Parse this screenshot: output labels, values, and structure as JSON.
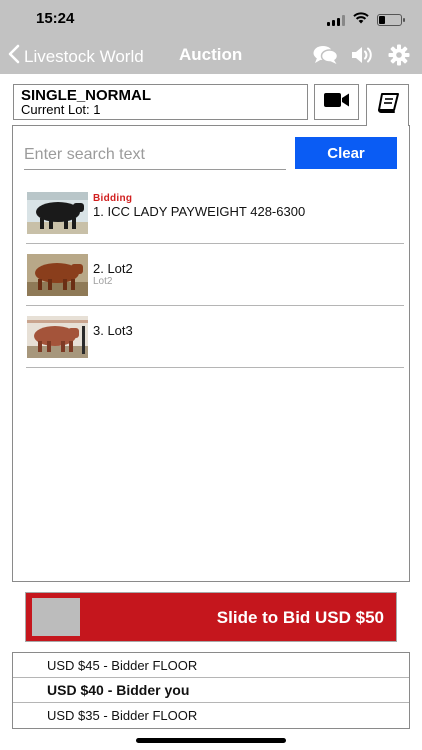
{
  "status_bar": {
    "time": "15:24"
  },
  "nav": {
    "back_label": "Livestock World",
    "title": "Auction",
    "icons": [
      "chat-icon",
      "speaker-icon",
      "gear-icon"
    ]
  },
  "lot_header": {
    "type": "SINGLE_NORMAL",
    "current_lot": "Current Lot: 1",
    "video_icon": "video-camera-icon",
    "catalog_icon": "book-icon"
  },
  "search": {
    "placeholder": "Enter search text",
    "value": "",
    "clear_label": "Clear"
  },
  "lots": [
    {
      "status": "Bidding",
      "name": "1. ICC LADY PAYWEIGHT 428-6300",
      "subtitle": "",
      "color": "#1a1a1a"
    },
    {
      "status": "",
      "name": "2. Lot2",
      "subtitle": "Lot2",
      "color": "#8a3e1c"
    },
    {
      "status": "",
      "name": "3. Lot3",
      "subtitle": "",
      "color": "#a4543a"
    }
  ],
  "slide_bid": {
    "label": "Slide to Bid USD $50"
  },
  "bids": [
    {
      "text": "USD $45 - Bidder FLOOR",
      "mine": false
    },
    {
      "text": "USD $40 - Bidder you",
      "mine": true
    },
    {
      "text": "USD $35 - Bidder FLOOR",
      "mine": false
    }
  ],
  "colors": {
    "bar": "#c2c2c2",
    "accent_blue": "#0a5cf4",
    "bid_red": "#c5161d",
    "status_red": "#d11f1f"
  }
}
